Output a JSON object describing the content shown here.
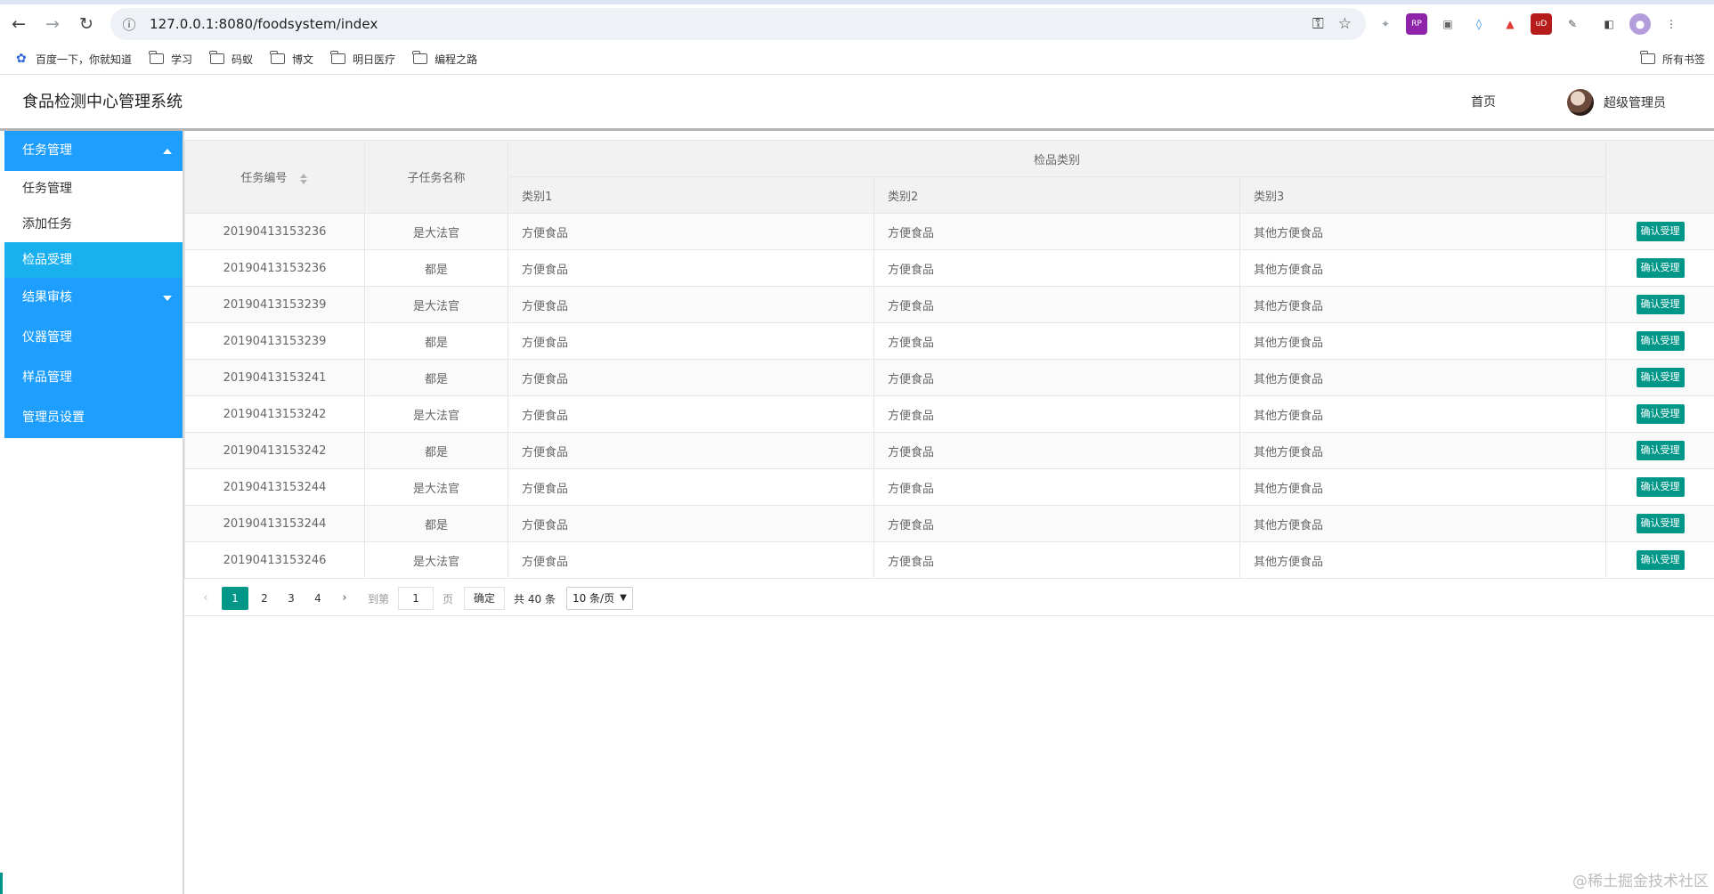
{
  "browser": {
    "url": "127.0.0.1:8080/foodsystem/index",
    "bookmarks": [
      "百度一下，你就知道",
      "学习",
      "码蚁",
      "博文",
      "明日医疗",
      "编程之路"
    ],
    "all_bookmarks_label": "所有书签"
  },
  "app": {
    "title": "食品检测中心管理系统",
    "home_label": "首页",
    "user_name": "超级管理员"
  },
  "sidebar": {
    "group_task": "任务管理",
    "sub_task_manage": "任务管理",
    "sub_add_task": "添加任务",
    "sub_sample_accept": "检品受理",
    "group_result_review": "结果审核",
    "group_instrument": "仪器管理",
    "group_sample": "样品管理",
    "group_admin": "管理员设置"
  },
  "table": {
    "headers": {
      "task_no": "任务编号",
      "subtask_name": "子任务名称",
      "category_group": "检品类别",
      "cat1": "类别1",
      "cat2": "类别2",
      "cat3": "类别3"
    },
    "action_label": "确认受理",
    "rows": [
      {
        "task_no": "20190413153236",
        "subtask": "是大法官",
        "cat1": "方便食品",
        "cat2": "方便食品",
        "cat3": "其他方便食品"
      },
      {
        "task_no": "20190413153236",
        "subtask": "都是",
        "cat1": "方便食品",
        "cat2": "方便食品",
        "cat3": "其他方便食品"
      },
      {
        "task_no": "20190413153239",
        "subtask": "是大法官",
        "cat1": "方便食品",
        "cat2": "方便食品",
        "cat3": "其他方便食品"
      },
      {
        "task_no": "20190413153239",
        "subtask": "都是",
        "cat1": "方便食品",
        "cat2": "方便食品",
        "cat3": "其他方便食品"
      },
      {
        "task_no": "20190413153241",
        "subtask": "都是",
        "cat1": "方便食品",
        "cat2": "方便食品",
        "cat3": "其他方便食品"
      },
      {
        "task_no": "20190413153242",
        "subtask": "是大法官",
        "cat1": "方便食品",
        "cat2": "方便食品",
        "cat3": "其他方便食品"
      },
      {
        "task_no": "20190413153242",
        "subtask": "都是",
        "cat1": "方便食品",
        "cat2": "方便食品",
        "cat3": "其他方便食品"
      },
      {
        "task_no": "20190413153244",
        "subtask": "是大法官",
        "cat1": "方便食品",
        "cat2": "方便食品",
        "cat3": "其他方便食品"
      },
      {
        "task_no": "20190413153244",
        "subtask": "都是",
        "cat1": "方便食品",
        "cat2": "方便食品",
        "cat3": "其他方便食品"
      },
      {
        "task_no": "20190413153246",
        "subtask": "是大法官",
        "cat1": "方便食品",
        "cat2": "方便食品",
        "cat3": "其他方便食品"
      }
    ]
  },
  "pager": {
    "pages": [
      "1",
      "2",
      "3",
      "4"
    ],
    "current": "1",
    "goto_prefix": "到第",
    "goto_value": "1",
    "goto_suffix": "页",
    "confirm_label": "确定",
    "total_text": "共 40 条",
    "page_size": "10 条/页"
  },
  "watermark": "@稀土掘金技术社区",
  "colors": {
    "sidebar_blue": "#1e9fff",
    "sidebar_selected": "#1ab0f0",
    "accent_green": "#009688"
  }
}
